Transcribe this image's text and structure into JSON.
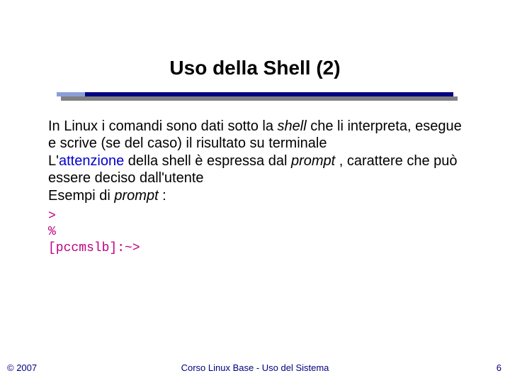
{
  "title": "Uso della Shell (2)",
  "body": {
    "p1a": "In Linux i comandi sono dati sotto la ",
    "p1b": "shell",
    "p1c": " che li interpreta, esegue e scrive (se del caso) il risultato su terminale",
    "p2a": "L'",
    "p2b": "attenzione",
    "p2c": " della shell è espressa dal ",
    "p2d": "prompt",
    "p2e": " , carattere che può essere deciso dall'utente",
    "p3a": "Esempi di ",
    "p3b": "prompt",
    "p3c": " :"
  },
  "code": {
    "l1": ">",
    "l2": "%",
    "l3": "[pccmslb]:~>"
  },
  "footer": {
    "copyright": "© 2007",
    "center": "Corso Linux Base - Uso del Sistema",
    "page": "6"
  }
}
